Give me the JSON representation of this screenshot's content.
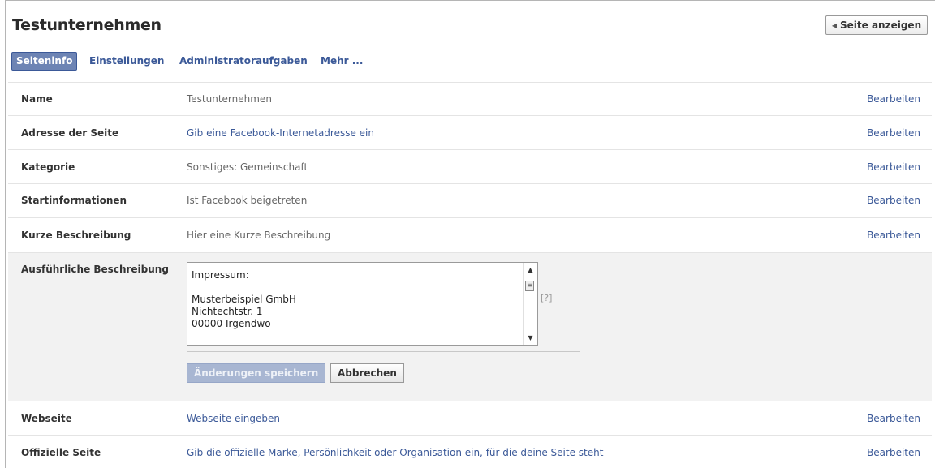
{
  "header": {
    "title": "Testunternehmen",
    "view_page_button": "Seite anzeigen",
    "view_page_icon": "triangle-left-icon"
  },
  "tabs": [
    {
      "label": "Seiteninfo",
      "active": true
    },
    {
      "label": "Einstellungen",
      "active": false
    },
    {
      "label": "Administratoraufgaben",
      "active": false
    },
    {
      "label": "Mehr ...",
      "active": false
    }
  ],
  "fields": {
    "name": {
      "label": "Name",
      "value": "Testunternehmen",
      "edit": "Bearbeiten"
    },
    "address": {
      "label": "Adresse der Seite",
      "value": "Gib eine Facebook-Internetadresse ein",
      "edit": "Bearbeiten"
    },
    "category": {
      "label": "Kategorie",
      "value": "Sonstiges: Gemeinschaft",
      "edit": "Bearbeiten"
    },
    "start_info": {
      "label": "Startinformationen",
      "value": "Ist Facebook beigetreten",
      "edit": "Bearbeiten"
    },
    "short_desc": {
      "label": "Kurze Beschreibung",
      "value": "Hier eine Kurze Beschreibung",
      "edit": "Bearbeiten"
    },
    "long_desc": {
      "label": "Ausführliche Beschreibung",
      "lines": [
        "Impressum:",
        "",
        "Musterbeispiel GmbH",
        "Nichtechtstr. 1",
        "00000 Irgendwo"
      ],
      "help": "[?]",
      "save_button": "Änderungen speichern",
      "cancel_button": "Abbrechen"
    },
    "website": {
      "label": "Webseite",
      "value": "Webseite eingeben",
      "edit": "Bearbeiten"
    },
    "official_page": {
      "label": "Offizielle Seite",
      "value": "Gib die offizielle Marke, Persönlichkeit oder Organisation ein, für die deine Seite steht",
      "edit": "Bearbeiten"
    }
  },
  "colors": {
    "link": "#3b5998",
    "active_tab": "#6d84b4",
    "expanded_row_bg": "#f2f2f2"
  }
}
